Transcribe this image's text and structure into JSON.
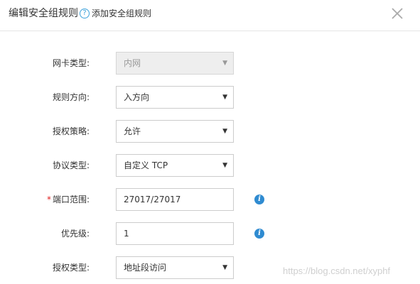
{
  "dialog": {
    "title": "编辑安全组规则",
    "help_icon": "question-circle-icon",
    "help_link": "添加安全组规则",
    "close_icon": "close-icon"
  },
  "form": {
    "nic_type": {
      "label": "网卡类型:",
      "value": "内网",
      "disabled": true
    },
    "direction": {
      "label": "规则方向:",
      "value": "入方向"
    },
    "policy": {
      "label": "授权策略:",
      "value": "允许"
    },
    "protocol": {
      "label": "协议类型:",
      "value": "自定义 TCP"
    },
    "port_range": {
      "label": "端口范围:",
      "required_mark": "*",
      "value": "27017/27017",
      "info_icon": "info-icon"
    },
    "priority": {
      "label": "优先级:",
      "value": "1",
      "info_icon": "info-icon"
    },
    "auth_type": {
      "label": "授权类型:",
      "value": "地址段访问"
    }
  },
  "watermark": "https://blog.csdn.net/xyphf",
  "colors": {
    "accent": "#2f8bd1",
    "required": "#e02020",
    "disabled_bg": "#eeeeee",
    "border": "#cccccc"
  }
}
